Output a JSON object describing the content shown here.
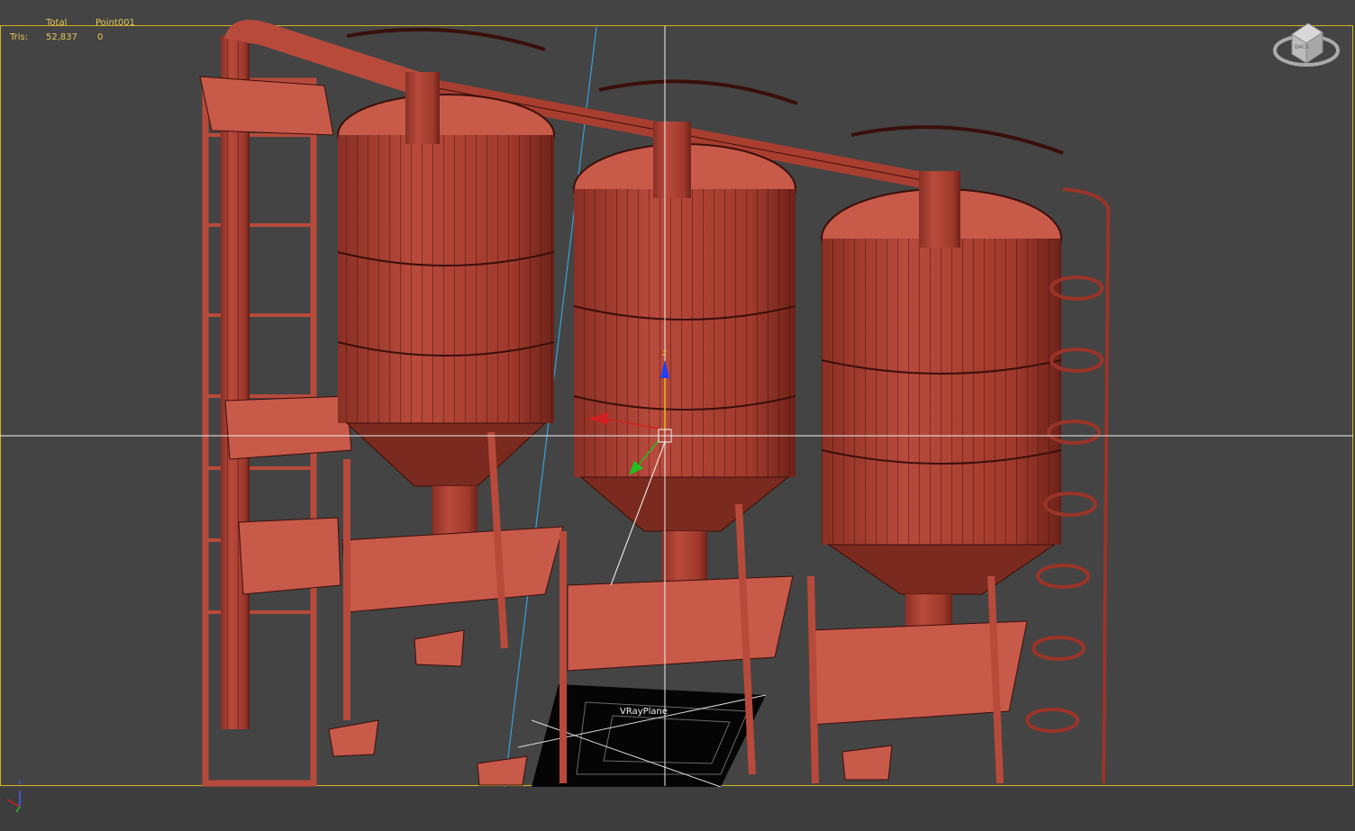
{
  "viewport": {
    "stats": {
      "col_total": "Total",
      "col_object": "Point001",
      "row_label": "Tris:",
      "tris_total": "52,837",
      "tris_object": "0"
    },
    "viewcube_face": "BACK",
    "object_label": "VRayPlane",
    "gizmo_axis_z": "z"
  },
  "colors": {
    "background": "#444444",
    "frame": "#d6b21f",
    "model_fill": "#b84a3c",
    "model_wire": "#3a0f0a",
    "stats_text": "#e3c95a"
  }
}
